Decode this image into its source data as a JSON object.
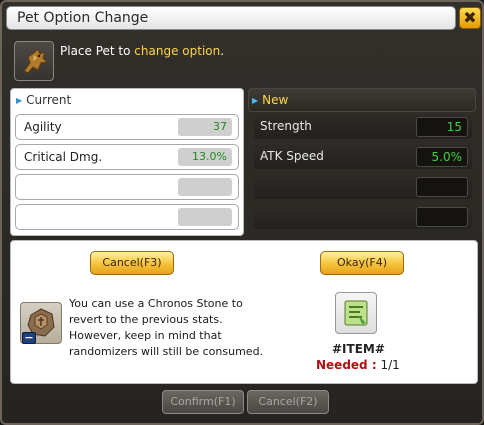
{
  "window": {
    "title": "Pet Option Change",
    "close_label": "✖"
  },
  "instruction": {
    "prefix": "Place Pet to ",
    "highlight": "change option",
    "suffix": "."
  },
  "current": {
    "header": "Current",
    "rows": [
      {
        "name": "Agility",
        "value": "37"
      },
      {
        "name": "Critical Dmg.",
        "value": "13.0%"
      },
      {
        "name": "",
        "value": ""
      },
      {
        "name": "",
        "value": ""
      }
    ]
  },
  "new": {
    "header": "New",
    "rows": [
      {
        "name": "Strength",
        "value": "15"
      },
      {
        "name": "ATK Speed",
        "value": "5.0%"
      },
      {
        "name": "",
        "value": ""
      },
      {
        "name": "",
        "value": ""
      }
    ]
  },
  "info": {
    "cancel_f3_label": "Cancel(F3)",
    "okay_f4_label": "Okay(F4)",
    "chronos_lines": [
      "You can use a Chronos Stone to",
      "revert to the previous stats.",
      "However, keep in mind that",
      "randomizers will still be consumed."
    ],
    "item_name": "#ITEM#",
    "needed_label": "Needed :",
    "needed_value": "1/1"
  },
  "footer": {
    "confirm_label": "Confirm(F1)",
    "cancel_f2_label": "Cancel(F2)"
  },
  "colors": {
    "accent_yellow": "#ffd54a",
    "value_green": "#3fd13f",
    "needed_red": "#b01010"
  },
  "icons": {
    "pet": "dragon-pet-icon",
    "stone": "chronos-stone-icon",
    "item": "scroll-item-icon"
  }
}
